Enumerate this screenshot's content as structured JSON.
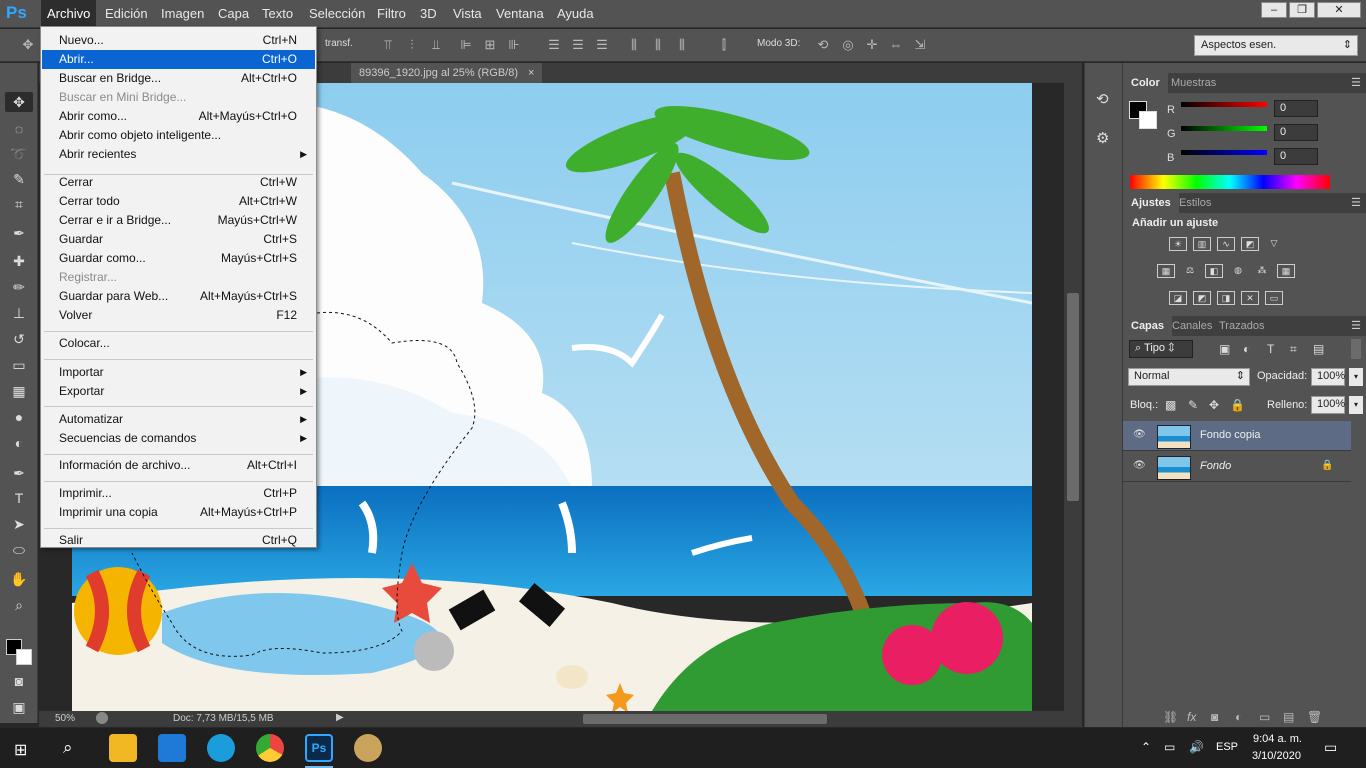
{
  "app": {
    "logo": "Ps"
  },
  "menubar": {
    "items": [
      "Archivo",
      "Edición",
      "Imagen",
      "Capa",
      "Texto",
      "Selección",
      "Filtro",
      "3D",
      "Vista",
      "Ventana",
      "Ayuda"
    ]
  },
  "options": {
    "transform_label": "transf.",
    "mode3d_label": "Modo 3D:",
    "workspace": "Aspectos esen."
  },
  "document": {
    "tab_title": "89396_1920.jpg al 25% (RGB/8)",
    "zoom": "50%",
    "doc_info": "Doc: 7,73 MB/15,5 MB"
  },
  "file_menu": {
    "items": [
      {
        "label": "Nuevo...",
        "shortcut": "Ctrl+N"
      },
      {
        "label": "Abrir...",
        "shortcut": "Ctrl+O"
      },
      {
        "label": "Buscar en Bridge...",
        "shortcut": "Alt+Ctrl+O"
      },
      {
        "label": "Buscar en Mini Bridge...",
        "shortcut": ""
      },
      {
        "label": "Abrir como...",
        "shortcut": "Alt+Mayús+Ctrl+O"
      },
      {
        "label": "Abrir como objeto inteligente...",
        "shortcut": ""
      },
      {
        "label": "Abrir recientes",
        "shortcut": ""
      },
      {
        "label": "Cerrar",
        "shortcut": "Ctrl+W"
      },
      {
        "label": "Cerrar todo",
        "shortcut": "Alt+Ctrl+W"
      },
      {
        "label": "Cerrar e ir a Bridge...",
        "shortcut": "Mayús+Ctrl+W"
      },
      {
        "label": "Guardar",
        "shortcut": "Ctrl+S"
      },
      {
        "label": "Guardar como...",
        "shortcut": "Mayús+Ctrl+S"
      },
      {
        "label": "Registrar...",
        "shortcut": ""
      },
      {
        "label": "Guardar para Web...",
        "shortcut": "Alt+Mayús+Ctrl+S"
      },
      {
        "label": "Volver",
        "shortcut": "F12"
      },
      {
        "label": "Colocar...",
        "shortcut": ""
      },
      {
        "label": "Importar",
        "shortcut": ""
      },
      {
        "label": "Exportar",
        "shortcut": ""
      },
      {
        "label": "Automatizar",
        "shortcut": ""
      },
      {
        "label": "Secuencias de comandos",
        "shortcut": ""
      },
      {
        "label": "Información de archivo...",
        "shortcut": "Alt+Ctrl+I"
      },
      {
        "label": "Imprimir...",
        "shortcut": "Ctrl+P"
      },
      {
        "label": "Imprimir una copia",
        "shortcut": "Alt+Mayús+Ctrl+P"
      },
      {
        "label": "Salir",
        "shortcut": "Ctrl+Q"
      }
    ]
  },
  "color_panel": {
    "tabs": [
      "Color",
      "Muestras"
    ],
    "r_label": "R",
    "g_label": "G",
    "b_label": "B",
    "r": "0",
    "g": "0",
    "b": "0"
  },
  "adjust_panel": {
    "tabs": [
      "Ajustes",
      "Estilos"
    ],
    "heading": "Añadir un ajuste"
  },
  "layers_panel": {
    "tabs": [
      "Capas",
      "Canales",
      "Trazados"
    ],
    "filter": "Tipo",
    "blend_mode": "Normal",
    "opacity_label": "Opacidad:",
    "opacity": "100%",
    "lock_label": "Bloq.:",
    "fill_label": "Relleno:",
    "fill": "100%",
    "layers": [
      {
        "name": "Fondo copia"
      },
      {
        "name": "Fondo"
      }
    ]
  },
  "taskbar": {
    "lang": "ESP",
    "time": "9:04 a. m.",
    "date": "3/10/2020"
  },
  "colors": {
    "accent": "#0a64d2",
    "ps_blue": "#31a8ff",
    "panel": "#535353"
  }
}
